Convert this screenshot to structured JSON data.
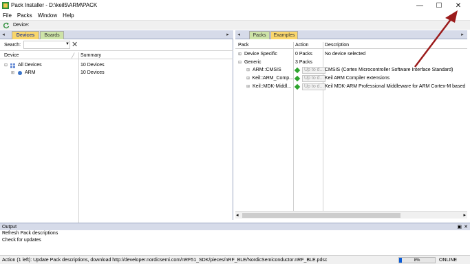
{
  "window": {
    "title": "Pack Installer - D:\\keil5\\ARM\\PACK",
    "controls": {
      "minimize": "—",
      "maximize": "☐",
      "close": "✕"
    }
  },
  "menu": [
    "File",
    "Packs",
    "Window",
    "Help"
  ],
  "toolbar": {
    "device_label": "Device:"
  },
  "left": {
    "tabs": {
      "devices": "Devices",
      "boards": "Boards"
    },
    "search_label": "Search:",
    "search_value": "",
    "columns": {
      "device": "Device",
      "summary": "Summary"
    },
    "rows": [
      {
        "name": "All Devices",
        "summary": "10 Devices",
        "expander": "⊟"
      },
      {
        "name": "ARM",
        "summary": "10 Devices",
        "expander": "⊞"
      }
    ]
  },
  "right": {
    "tabs": {
      "packs": "Packs",
      "examples": "Examples"
    },
    "columns": {
      "pack": "Pack",
      "action": "Action",
      "description": "Description"
    },
    "rows": [
      {
        "pack": "Device Specific",
        "action": "0 Packs",
        "description": "No device selected",
        "expander": "⊞"
      },
      {
        "pack": "Generic",
        "action": "3 Packs",
        "description": "",
        "expander": "⊟"
      },
      {
        "pack": "ARM::CMSIS",
        "action": "Up to d...",
        "description": "CMSIS (Cortex Microcontroller Software Interface Standard)",
        "expander": "⊞"
      },
      {
        "pack": "Keil::ARM_Comp...",
        "action": "Up to d...",
        "description": "Keil ARM Compiler extensions",
        "expander": "⊞"
      },
      {
        "pack": "Keil::MDK-Middl...",
        "action": "Up to d...",
        "description": "Keil MDK-ARM Professional Middleware for ARM Cortex-M based",
        "expander": "⊞"
      }
    ]
  },
  "output": {
    "title": "Output",
    "lines": [
      "Refresh Pack descriptions",
      "Check for updates"
    ]
  },
  "status": {
    "text": "Action (1 left): Update Pack descriptions, download http://developer.nordicsemi.com/nRF51_SDK/pieces/nRF_BLE/NordicSemiconductor.nRF_BLE.pdsc",
    "progress_label": "8%",
    "progress_value": 0.08,
    "connection": "ONLINE"
  },
  "colors": {
    "tab_active": "#f9d66b",
    "tab_inactive": "#cde3a7",
    "progress": "#0a5bd6",
    "annotation": "#9b1b1b"
  }
}
